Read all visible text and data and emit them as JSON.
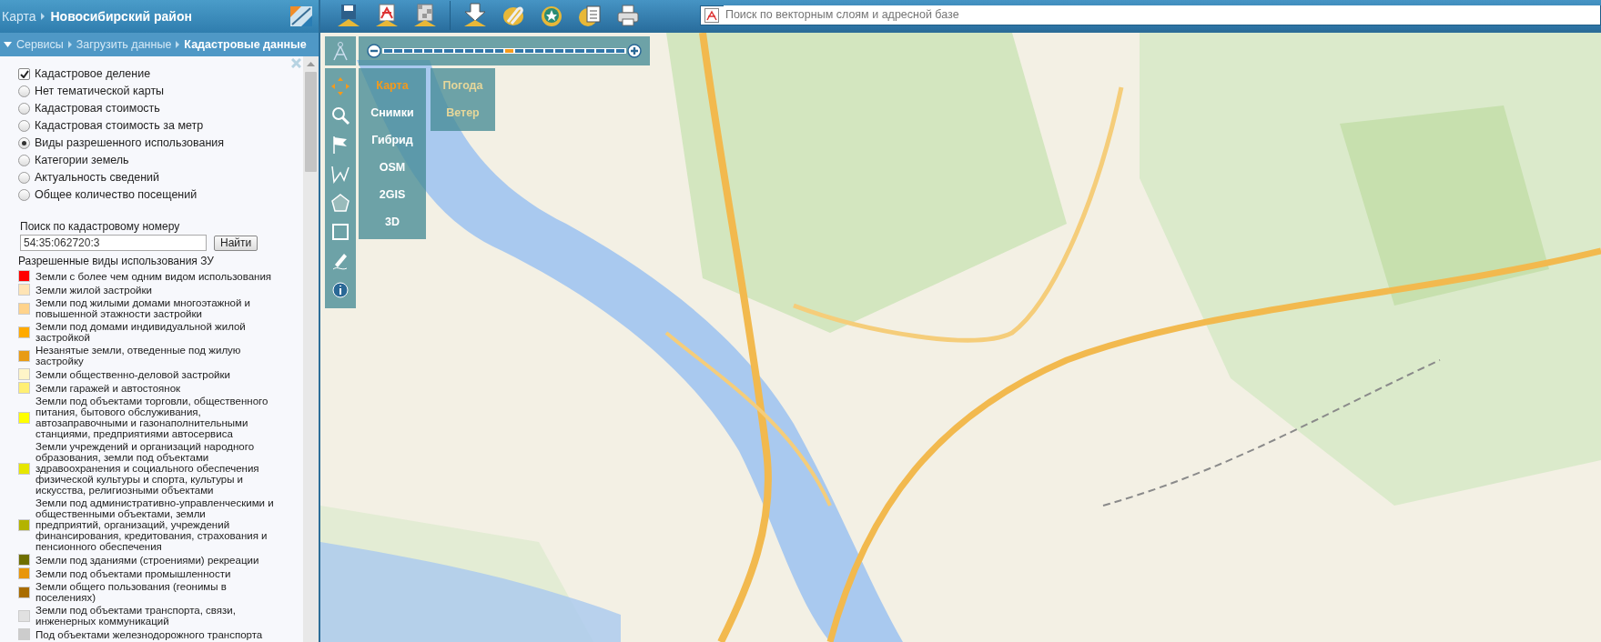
{
  "header": {
    "breadcrumb": [
      {
        "label": "Карта",
        "current": false
      },
      {
        "label": "Новосибирский район",
        "current": true
      }
    ]
  },
  "panel_breadcrumb": [
    {
      "label": "Сервисы",
      "current": false
    },
    {
      "label": "Загрузить данные",
      "current": false
    },
    {
      "label": "Кадастровые данные",
      "current": true
    }
  ],
  "layers": [
    {
      "kind": "checkbox",
      "label": "Кадастровое деление",
      "checked": true
    },
    {
      "kind": "radio",
      "label": "Нет тематической карты",
      "selected": false
    },
    {
      "kind": "radio",
      "label": "Кадастровая стоимость",
      "selected": false
    },
    {
      "kind": "radio",
      "label": "Кадастровая стоимость за метр",
      "selected": false
    },
    {
      "kind": "radio",
      "label": "Виды разрешенного использования",
      "selected": true
    },
    {
      "kind": "radio",
      "label": "Категории земель",
      "selected": false
    },
    {
      "kind": "radio",
      "label": "Актуальность сведений",
      "selected": false
    },
    {
      "kind": "radio",
      "label": "Общее количество посещений",
      "selected": false
    }
  ],
  "cadastral_search": {
    "label": "Поиск по кадастровому номеру",
    "value": "54:35:062720:3",
    "button": "Найти"
  },
  "legend": {
    "title": "Разрешенные виды использования ЗУ",
    "items": [
      {
        "label": "Земли с более чем одним видом использования",
        "color": "#ff0000"
      },
      {
        "label": "Земли жилой застройки",
        "color": "#ffe4b5"
      },
      {
        "label": "Земли под жилыми домами многоэтажной и повышенной этажности застройки",
        "color": "#ffd38c"
      },
      {
        "label": "Земли под домами индивидуальной жилой застройкой",
        "color": "#ffaa00"
      },
      {
        "label": "Незанятые земли, отведенные под жилую застройку",
        "color": "#e89b14"
      },
      {
        "label": "Земли общественно-деловой застройки",
        "color": "#fff5c8"
      },
      {
        "label": "Земли гаражей и автостоянок",
        "color": "#ffef73"
      },
      {
        "label": "Земли под объектами торговли, общественного питания, бытового обслуживания, автозаправочными и газонаполнительными станциями, предприятиями автосервиса",
        "color": "#ffff00"
      },
      {
        "label": "Земли учреждений и организаций народного образования, земли под объектами здравоохранения и социального обеспечения физической культуры и спорта, культуры и искусства, религиозными объектами",
        "color": "#e6e600"
      },
      {
        "label": "Земли под административно-управленческими и общественными объектами, земли предприятий, организаций, учреждений финансирования, кредитования, страхования и пенсионного обеспечения",
        "color": "#b3b300"
      },
      {
        "label": "Земли под зданиями (строениями) рекреации",
        "color": "#6e6e00"
      },
      {
        "label": "Земли под объектами промышленности",
        "color": "#e8960a"
      },
      {
        "label": "Земли общего пользования (геонимы в поселениях)",
        "color": "#a86c00"
      },
      {
        "label": "Земли под объектами транспорта, связи, инженерных коммуникаций",
        "color": "#e1e1e1"
      },
      {
        "label": "Под объектами железнодорожного транспорта",
        "color": "#cccccc"
      }
    ]
  },
  "search": {
    "placeholder": "Поиск по векторным слоям и адресной базе"
  },
  "zoom": {
    "level": 0.52
  },
  "map_tools": [
    {
      "kind": "pan",
      "selected": true
    },
    {
      "kind": "zoom",
      "selected": false
    },
    {
      "kind": "flag",
      "selected": false
    },
    {
      "kind": "polyline",
      "selected": false
    },
    {
      "kind": "polygon",
      "selected": false
    },
    {
      "kind": "rectangle",
      "selected": false
    },
    {
      "kind": "pen",
      "selected": false
    },
    {
      "kind": "info",
      "selected": false
    }
  ],
  "base_layers": [
    {
      "label": "Карта",
      "selected": true
    },
    {
      "label": "Снимки",
      "selected": false
    },
    {
      "label": "Гибрид",
      "selected": false
    },
    {
      "label": "OSM",
      "selected": false
    },
    {
      "label": "2GIS",
      "selected": false
    },
    {
      "label": "3D",
      "selected": false
    }
  ],
  "overlays": [
    {
      "label": "Погода",
      "on": false
    },
    {
      "label": "Ветер",
      "on": false
    }
  ]
}
